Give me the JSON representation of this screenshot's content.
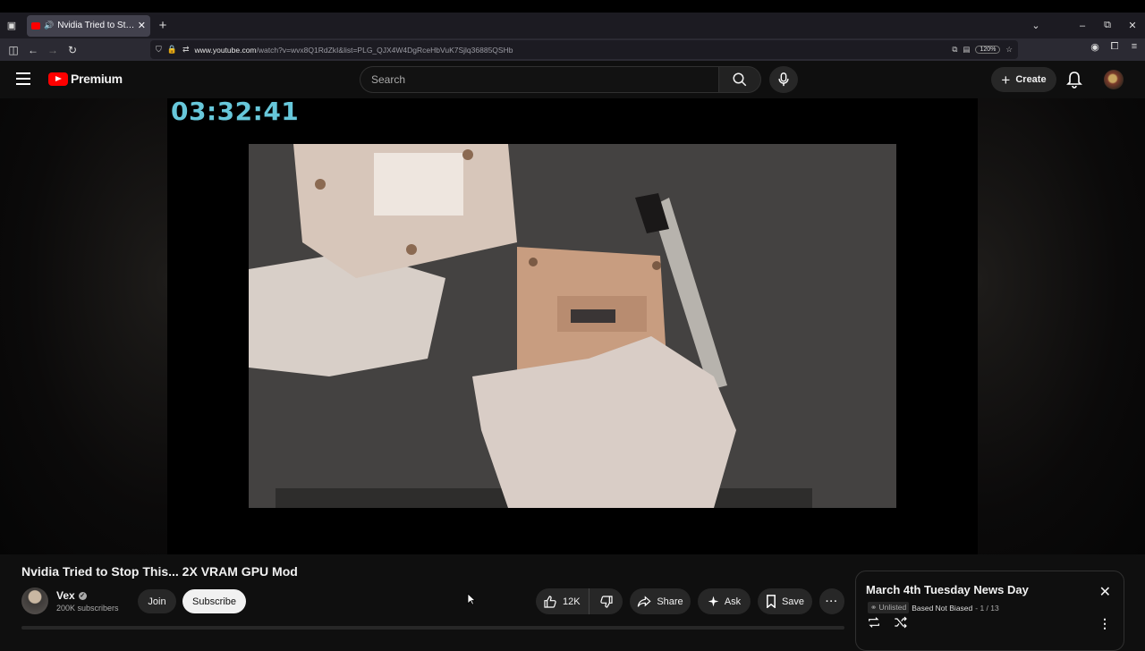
{
  "browser": {
    "tab_title": "Nvidia Tried to Stop This... 2X VRAM GPU Mod",
    "url_host": "www.youtube.com",
    "url_path": "/watch?v=wvx8Q1RdZkI&list=PLG_QJX4W4DgRceHbVuK7Sjlq36885QSHb",
    "zoom": "120%"
  },
  "header": {
    "logo_text": "Premium",
    "search_placeholder": "Search",
    "create_label": "Create"
  },
  "player": {
    "timer_overlay": "03:32:41"
  },
  "video": {
    "title": "Nvidia Tried to Stop This... 2X VRAM GPU Mod",
    "channel_name": "Vex",
    "subscribers": "200K subscribers",
    "join_label": "Join",
    "subscribe_label": "Subscribe",
    "likes": "12K",
    "share_label": "Share",
    "ask_label": "Ask",
    "save_label": "Save"
  },
  "playlist": {
    "title": "March 4th Tuesday News Day",
    "visibility": "Unlisted",
    "owner": "Based Not Biased",
    "position": "- 1 / 13"
  },
  "colors": {
    "timer": "#67c7da",
    "brand_red": "#ff0000",
    "background": "#0f0f0f"
  }
}
